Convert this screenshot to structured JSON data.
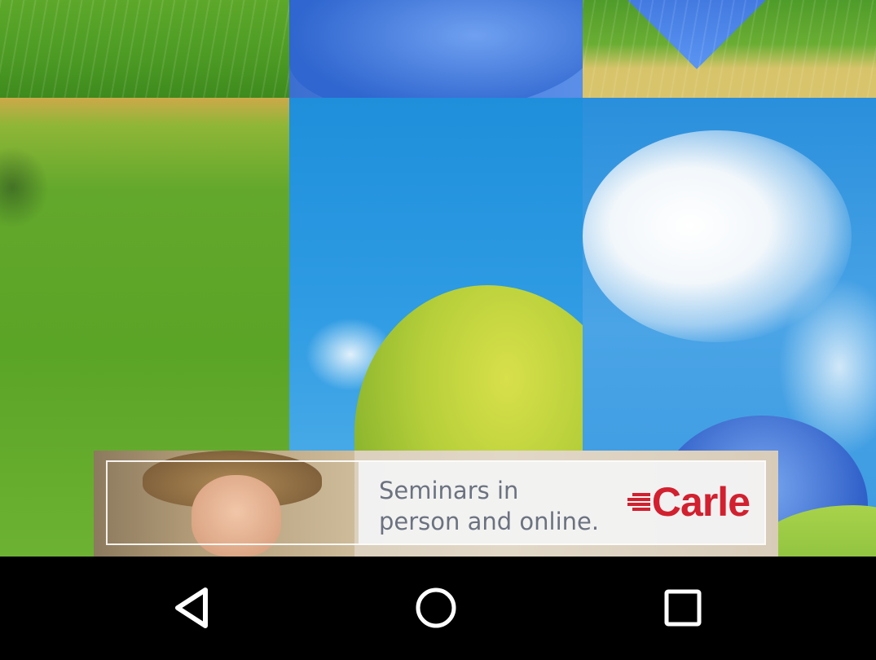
{
  "puzzle": {
    "tiles": [
      {
        "id": "tile-r0-c0",
        "scene": "grass"
      },
      {
        "id": "tile-r0-c1",
        "scene": "blue-shape"
      },
      {
        "id": "tile-r0-c2",
        "scene": "grass-and-path"
      },
      {
        "id": "tile-r1-c0",
        "scene": "grass"
      },
      {
        "id": "tile-r1-c1",
        "scene": "sky-with-bush"
      },
      {
        "id": "tile-r1-c2",
        "scene": "sky-with-cloud"
      }
    ]
  },
  "ad": {
    "headline": "Seminars in\nperson and online.",
    "brand": "Carle",
    "brand_color": "#d2202f"
  },
  "navbar": {
    "back_icon": "back-triangle-icon",
    "home_icon": "home-circle-icon",
    "recents_icon": "recents-square-icon",
    "icon_color": "#ffffff"
  }
}
